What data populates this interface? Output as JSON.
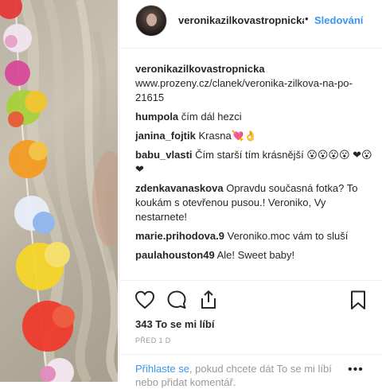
{
  "post": {
    "username": "veronikazilkovastropnicka",
    "follow_dot": "•",
    "follow_label": "Sledování",
    "avatar_icon": "profile-photo",
    "photo_icon": "flower-lei-photo"
  },
  "comments": [
    {
      "user": "veronikazilkovastropnicka",
      "text": "www.prozeny.cz/clanek/veronika-zilkova-na-po-21615"
    },
    {
      "user": "humpola",
      "text": "čím dál hezci"
    },
    {
      "user": "janina_fojtik",
      "text": "Krasna💘👌"
    },
    {
      "user": "babu_vlasti",
      "text": "Čím starší tím krásnější 😮😮😮😮 ❤😮❤"
    },
    {
      "user": "zdenkavanaskova",
      "text": "Opravdu současná fotka? To koukám s otevřenou pusou.! Veroniko, Vy nestarnete!"
    },
    {
      "user": "marie.prihodova.9",
      "text": "Veroniko.moc vám to sluší"
    },
    {
      "user": "paulahouston49",
      "text": "Ale! Sweet baby!"
    }
  ],
  "actions": {
    "like_icon": "heart-icon",
    "comment_icon": "comment-icon",
    "share_icon": "share-icon",
    "save_icon": "bookmark-icon",
    "likes_text": "343 To se mi líbí",
    "time_text": "PŘED 1 D"
  },
  "login": {
    "link_text": "Přihlaste se",
    "rest_text": ", pokud chcete dát To se mi líbí nebo přidat komentář.",
    "more_icon": "more-options-icon",
    "more_text": "•••"
  },
  "colors": {
    "link": "#3897f0",
    "text": "#262626",
    "muted": "#999999",
    "border": "#efefef"
  }
}
